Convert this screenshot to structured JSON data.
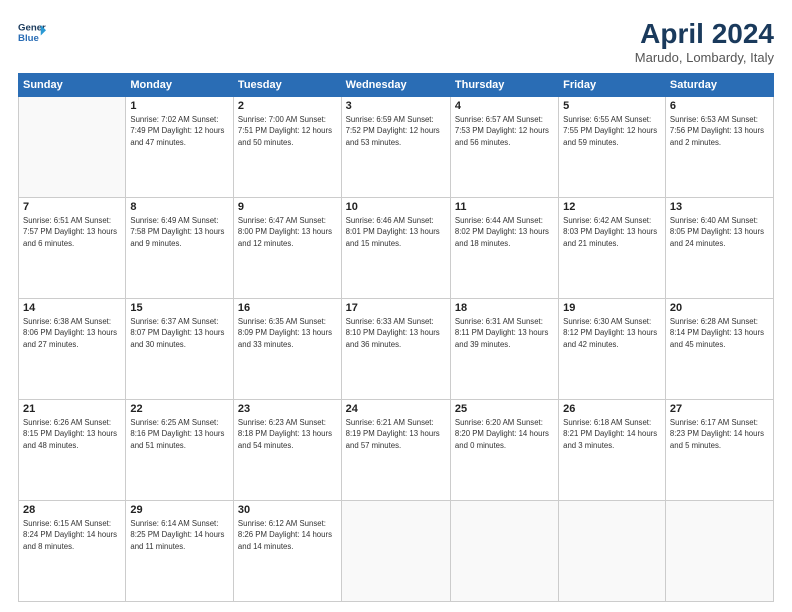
{
  "logo": {
    "line1": "General",
    "line2": "Blue"
  },
  "title": "April 2024",
  "subtitle": "Marudo, Lombardy, Italy",
  "days_header": [
    "Sunday",
    "Monday",
    "Tuesday",
    "Wednesday",
    "Thursday",
    "Friday",
    "Saturday"
  ],
  "weeks": [
    [
      {
        "num": "",
        "info": ""
      },
      {
        "num": "1",
        "info": "Sunrise: 7:02 AM\nSunset: 7:49 PM\nDaylight: 12 hours\nand 47 minutes."
      },
      {
        "num": "2",
        "info": "Sunrise: 7:00 AM\nSunset: 7:51 PM\nDaylight: 12 hours\nand 50 minutes."
      },
      {
        "num": "3",
        "info": "Sunrise: 6:59 AM\nSunset: 7:52 PM\nDaylight: 12 hours\nand 53 minutes."
      },
      {
        "num": "4",
        "info": "Sunrise: 6:57 AM\nSunset: 7:53 PM\nDaylight: 12 hours\nand 56 minutes."
      },
      {
        "num": "5",
        "info": "Sunrise: 6:55 AM\nSunset: 7:55 PM\nDaylight: 12 hours\nand 59 minutes."
      },
      {
        "num": "6",
        "info": "Sunrise: 6:53 AM\nSunset: 7:56 PM\nDaylight: 13 hours\nand 2 minutes."
      }
    ],
    [
      {
        "num": "7",
        "info": "Sunrise: 6:51 AM\nSunset: 7:57 PM\nDaylight: 13 hours\nand 6 minutes."
      },
      {
        "num": "8",
        "info": "Sunrise: 6:49 AM\nSunset: 7:58 PM\nDaylight: 13 hours\nand 9 minutes."
      },
      {
        "num": "9",
        "info": "Sunrise: 6:47 AM\nSunset: 8:00 PM\nDaylight: 13 hours\nand 12 minutes."
      },
      {
        "num": "10",
        "info": "Sunrise: 6:46 AM\nSunset: 8:01 PM\nDaylight: 13 hours\nand 15 minutes."
      },
      {
        "num": "11",
        "info": "Sunrise: 6:44 AM\nSunset: 8:02 PM\nDaylight: 13 hours\nand 18 minutes."
      },
      {
        "num": "12",
        "info": "Sunrise: 6:42 AM\nSunset: 8:03 PM\nDaylight: 13 hours\nand 21 minutes."
      },
      {
        "num": "13",
        "info": "Sunrise: 6:40 AM\nSunset: 8:05 PM\nDaylight: 13 hours\nand 24 minutes."
      }
    ],
    [
      {
        "num": "14",
        "info": "Sunrise: 6:38 AM\nSunset: 8:06 PM\nDaylight: 13 hours\nand 27 minutes."
      },
      {
        "num": "15",
        "info": "Sunrise: 6:37 AM\nSunset: 8:07 PM\nDaylight: 13 hours\nand 30 minutes."
      },
      {
        "num": "16",
        "info": "Sunrise: 6:35 AM\nSunset: 8:09 PM\nDaylight: 13 hours\nand 33 minutes."
      },
      {
        "num": "17",
        "info": "Sunrise: 6:33 AM\nSunset: 8:10 PM\nDaylight: 13 hours\nand 36 minutes."
      },
      {
        "num": "18",
        "info": "Sunrise: 6:31 AM\nSunset: 8:11 PM\nDaylight: 13 hours\nand 39 minutes."
      },
      {
        "num": "19",
        "info": "Sunrise: 6:30 AM\nSunset: 8:12 PM\nDaylight: 13 hours\nand 42 minutes."
      },
      {
        "num": "20",
        "info": "Sunrise: 6:28 AM\nSunset: 8:14 PM\nDaylight: 13 hours\nand 45 minutes."
      }
    ],
    [
      {
        "num": "21",
        "info": "Sunrise: 6:26 AM\nSunset: 8:15 PM\nDaylight: 13 hours\nand 48 minutes."
      },
      {
        "num": "22",
        "info": "Sunrise: 6:25 AM\nSunset: 8:16 PM\nDaylight: 13 hours\nand 51 minutes."
      },
      {
        "num": "23",
        "info": "Sunrise: 6:23 AM\nSunset: 8:18 PM\nDaylight: 13 hours\nand 54 minutes."
      },
      {
        "num": "24",
        "info": "Sunrise: 6:21 AM\nSunset: 8:19 PM\nDaylight: 13 hours\nand 57 minutes."
      },
      {
        "num": "25",
        "info": "Sunrise: 6:20 AM\nSunset: 8:20 PM\nDaylight: 14 hours\nand 0 minutes."
      },
      {
        "num": "26",
        "info": "Sunrise: 6:18 AM\nSunset: 8:21 PM\nDaylight: 14 hours\nand 3 minutes."
      },
      {
        "num": "27",
        "info": "Sunrise: 6:17 AM\nSunset: 8:23 PM\nDaylight: 14 hours\nand 5 minutes."
      }
    ],
    [
      {
        "num": "28",
        "info": "Sunrise: 6:15 AM\nSunset: 8:24 PM\nDaylight: 14 hours\nand 8 minutes."
      },
      {
        "num": "29",
        "info": "Sunrise: 6:14 AM\nSunset: 8:25 PM\nDaylight: 14 hours\nand 11 minutes."
      },
      {
        "num": "30",
        "info": "Sunrise: 6:12 AM\nSunset: 8:26 PM\nDaylight: 14 hours\nand 14 minutes."
      },
      {
        "num": "",
        "info": ""
      },
      {
        "num": "",
        "info": ""
      },
      {
        "num": "",
        "info": ""
      },
      {
        "num": "",
        "info": ""
      }
    ]
  ]
}
